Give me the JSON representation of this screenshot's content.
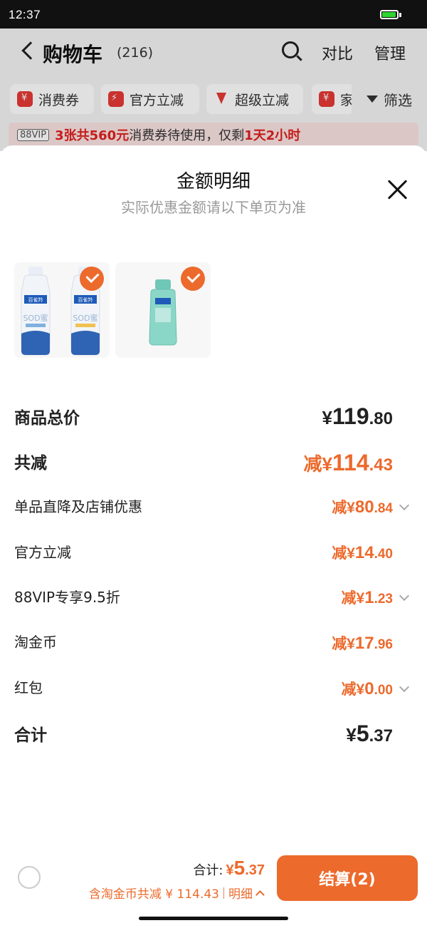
{
  "status_bar": {
    "time": "12:37"
  },
  "cart": {
    "title": "购物车",
    "count": "(216)",
    "compare_label": "对比",
    "manage_label": "管理",
    "filters": [
      {
        "label": "消费券",
        "icon": "ticket-icon"
      },
      {
        "label": "官方立减",
        "icon": "bolt-icon"
      },
      {
        "label": "超级立减",
        "icon": "down-arrow-icon"
      },
      {
        "label": "家",
        "icon": "coupon-icon"
      }
    ],
    "filter_button": "筛选",
    "vip_banner": {
      "tag": "88VIP",
      "highlight": "3张共560元",
      "text": "消费券待使用，仅剩",
      "remaining": "1天2小时"
    }
  },
  "sheet": {
    "title": "金额明细",
    "subtitle": "实际优惠金额请以下单页为准",
    "products": [
      {
        "name": "SOD蜜 two bottles",
        "checked": true
      },
      {
        "name": "small teal bottle",
        "checked": true
      }
    ],
    "rows": [
      {
        "label": "商品总价",
        "prefix": "¥",
        "int": "119",
        "dec": ".80"
      },
      {
        "label": "共减",
        "prefix": "减¥",
        "int": "114",
        "dec": ".43"
      },
      {
        "label": "单品直降及店铺优惠",
        "prefix": "减¥",
        "int": "80",
        "dec": ".84"
      },
      {
        "label": "官方立减",
        "prefix": "减¥",
        "int": "14",
        "dec": ".40"
      },
      {
        "label": "88VIP专享9.5折",
        "prefix": "减¥",
        "int": "1",
        "dec": ".23"
      },
      {
        "label": "淘金币",
        "prefix": "减¥",
        "int": "17",
        "dec": ".96"
      },
      {
        "label": "红包",
        "prefix": "减¥",
        "int": "0",
        "dec": ".00"
      },
      {
        "label": "合计",
        "prefix": "¥",
        "int": "5",
        "dec": ".37"
      }
    ]
  },
  "bottom_bar": {
    "total_label": "合计:",
    "total_prefix": "¥",
    "total_int": "5",
    "total_dec": ".37",
    "savings_text": "含淘金币共减 ¥ 114.43",
    "details_label": "明细",
    "checkout_label": "结算(2)"
  },
  "colors": {
    "accent": "#ec6a2c",
    "alert_red": "#e0221e",
    "battery_green": "#2ed52e"
  },
  "battery_level": 0.85
}
